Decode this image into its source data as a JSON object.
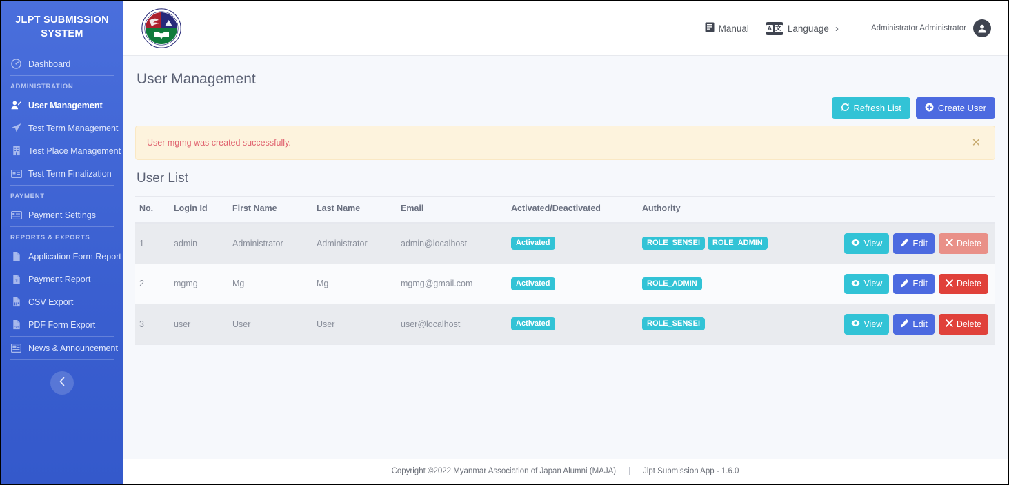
{
  "sidebar": {
    "brand": "JLPT SUBMISSION SYSTEM",
    "items": [
      {
        "label": "Dashboard",
        "icon": "tachometer-icon",
        "active": false
      },
      {
        "label": "User Management",
        "icon": "user-edit-icon",
        "active": true
      },
      {
        "label": "Test Term Management",
        "icon": "paper-plane-icon",
        "active": false
      },
      {
        "label": "Test Place Management",
        "icon": "building-icon",
        "active": false
      },
      {
        "label": "Test Term Finalization",
        "icon": "id-card-icon",
        "active": false
      },
      {
        "label": "Payment Settings",
        "icon": "credit-card-icon",
        "active": false
      },
      {
        "label": "Application Form Report",
        "icon": "file-icon",
        "active": false
      },
      {
        "label": "Payment Report",
        "icon": "file-invoice-icon",
        "active": false
      },
      {
        "label": "CSV Export",
        "icon": "file-csv-icon",
        "active": false
      },
      {
        "label": "PDF Form Export",
        "icon": "file-pdf-icon",
        "active": false
      },
      {
        "label": "News & Announcement",
        "icon": "newspaper-icon",
        "active": false
      }
    ],
    "sections": {
      "administration": "ADMINISTRATION",
      "payment": "PAYMENT",
      "reports": "REPORTS & EXPORTS"
    },
    "collapse_icon": "chevron-left-icon"
  },
  "header": {
    "logo_alt": "maja-logo",
    "manual_label": "Manual",
    "manual_icon": "book-icon",
    "language_label": "Language",
    "language_icon": "translate-icon",
    "language_chevron": "›",
    "user_name": "Administrator Administrator",
    "avatar_icon": "user-circle-icon"
  },
  "page": {
    "title": "User Management",
    "refresh_label": "Refresh List",
    "refresh_icon": "sync-icon",
    "create_label": "Create User",
    "create_icon": "plus-circle-icon",
    "alert_message": "User mgmg was created successfully.",
    "alert_close_icon": "close-icon",
    "list_title": "User List"
  },
  "table": {
    "columns": [
      "No.",
      "Login Id",
      "First Name",
      "Last Name",
      "Email",
      "Activated/Deactivated",
      "Authority"
    ],
    "rows": [
      {
        "no": "1",
        "login_id": "admin",
        "first_name": "Administrator",
        "last_name": "Administrator",
        "email": "admin@localhost",
        "status": "Activated",
        "roles": [
          "ROLE_SENSEI",
          "ROLE_ADMIN"
        ],
        "delete_muted": true
      },
      {
        "no": "2",
        "login_id": "mgmg",
        "first_name": "Mg",
        "last_name": "Mg",
        "email": "mgmg@gmail.com",
        "status": "Activated",
        "roles": [
          "ROLE_ADMIN"
        ],
        "delete_muted": false
      },
      {
        "no": "3",
        "login_id": "user",
        "first_name": "User",
        "last_name": "User",
        "email": "user@localhost",
        "status": "Activated",
        "roles": [
          "ROLE_SENSEI"
        ],
        "delete_muted": false
      }
    ],
    "actions": {
      "view_label": "View",
      "view_icon": "eye-icon",
      "edit_label": "Edit",
      "edit_icon": "pencil-icon",
      "delete_label": "Delete",
      "delete_icon": "times-icon"
    }
  },
  "footer": {
    "copyright": "Copyright ©2022 Myanmar Association of Japan Alumni (MAJA)",
    "separator": "|",
    "app_version": "Jlpt Submission App - 1.6.0"
  },
  "colors": {
    "sidebar": "#3f63d4",
    "teal": "#32c3d6",
    "indigo": "#4c6ae0",
    "danger": "#e0413a",
    "alert_bg": "#fdf3dd",
    "alert_text": "#e0626f"
  }
}
